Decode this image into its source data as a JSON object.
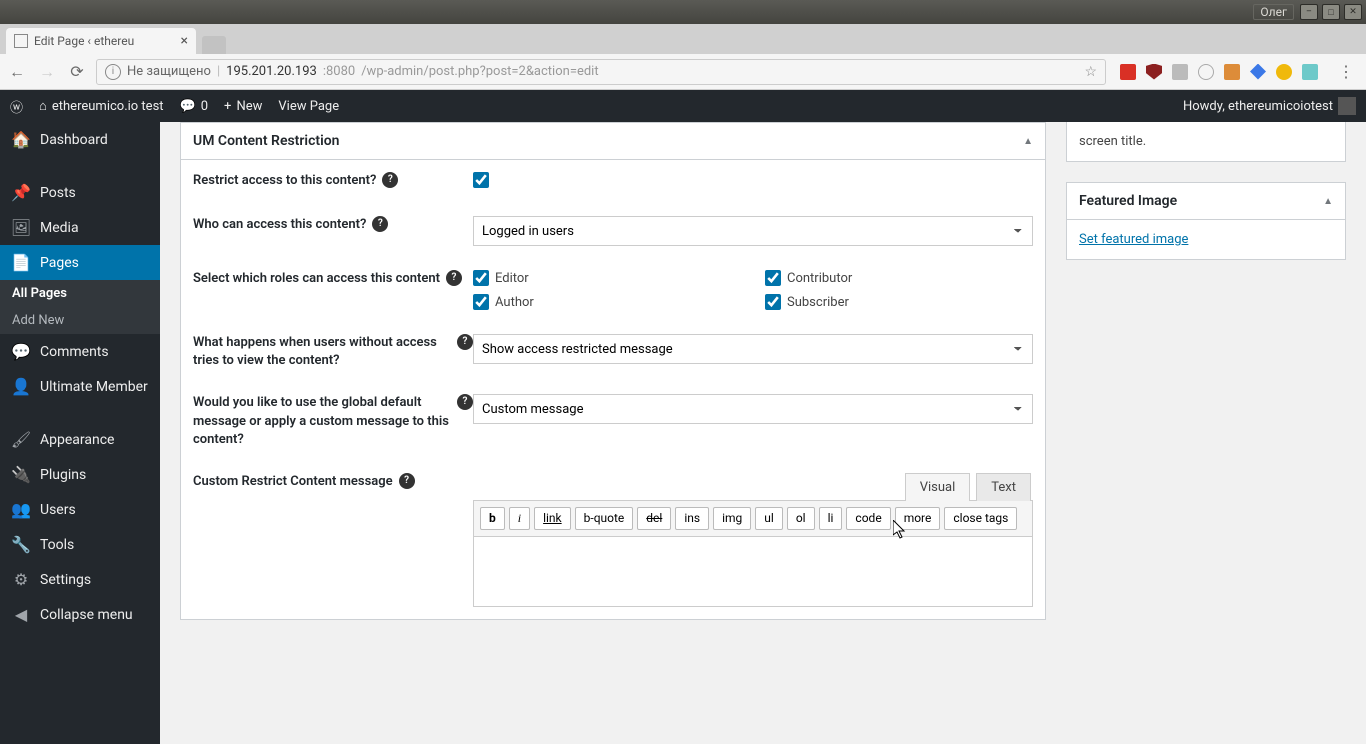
{
  "window": {
    "user": "Олег"
  },
  "browser": {
    "tab_title": "Edit Page ‹ ethereu",
    "not_secure": "Не защищено",
    "url_host": "195.201.20.193",
    "url_port": ":8080",
    "url_path": "/wp-admin/post.php?post=2&action=edit"
  },
  "adminbar": {
    "site": "ethereumico.io test",
    "comments": "0",
    "new": "New",
    "view": "View Page",
    "howdy": "Howdy, ethereumicoiotest"
  },
  "sidebar": {
    "dashboard": "Dashboard",
    "posts": "Posts",
    "media": "Media",
    "pages": "Pages",
    "all_pages": "All Pages",
    "add_new": "Add New",
    "comments": "Comments",
    "um": "Ultimate Member",
    "appearance": "Appearance",
    "plugins": "Plugins",
    "users": "Users",
    "tools": "Tools",
    "settings": "Settings",
    "collapse": "Collapse menu"
  },
  "meta": {
    "title": "UM Content Restriction",
    "restrict_label": "Restrict access to this content?",
    "who_label": "Who can access this content?",
    "who_value": "Logged in users",
    "roles_label": "Select which roles can access this content",
    "role_editor": "Editor",
    "role_author": "Author",
    "role_contributor": "Contributor",
    "role_subscriber": "Subscriber",
    "noaccess_label": "What happens when users without access tries to view the content?",
    "noaccess_value": "Show access restricted message",
    "msg_label": "Would you like to use the global default message or apply a custom message to this content?",
    "msg_value": "Custom message",
    "custom_label": "Custom Restrict Content message",
    "tab_visual": "Visual",
    "tab_text": "Text",
    "tb": {
      "b": "b",
      "i": "i",
      "link": "link",
      "bquote": "b-quote",
      "del": "del",
      "ins": "ins",
      "img": "img",
      "ul": "ul",
      "ol": "ol",
      "li": "li",
      "code": "code",
      "more": "more",
      "close": "close tags"
    }
  },
  "screen_note": "screen title.",
  "featured": {
    "title": "Featured Image",
    "link": "Set featured image"
  }
}
